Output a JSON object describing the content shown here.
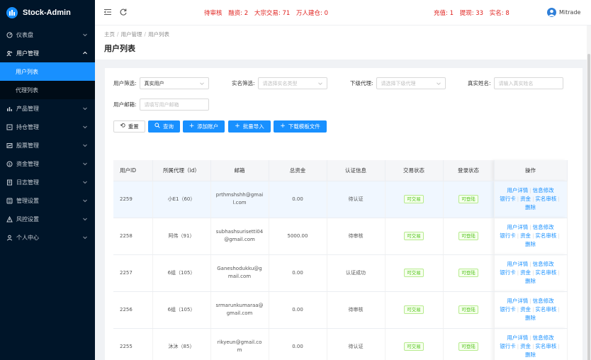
{
  "app": {
    "name": "Stock-Admin"
  },
  "sidebar": {
    "items": [
      {
        "label": "仪表盘",
        "icon": "dashboard-icon"
      },
      {
        "label": "用户管理",
        "icon": "users-icon",
        "open": true,
        "children": [
          {
            "label": "用户列表",
            "active": true
          },
          {
            "label": "代理列表"
          }
        ]
      },
      {
        "label": "产品管理",
        "icon": "chart-icon"
      },
      {
        "label": "持仓管理",
        "icon": "position-icon"
      },
      {
        "label": "股票管理",
        "icon": "stock-icon"
      },
      {
        "label": "资金管理",
        "icon": "money-icon"
      },
      {
        "label": "日志管理",
        "icon": "log-icon"
      },
      {
        "label": "管理设置",
        "icon": "settings-icon"
      },
      {
        "label": "风控设置",
        "icon": "warning-icon"
      },
      {
        "label": "个人中心",
        "icon": "person-icon"
      }
    ]
  },
  "topbar": {
    "stats_left": [
      "待审核",
      "融资: 2",
      "大宗交易: 71",
      "万人建仓: 0"
    ],
    "stats_right": [
      "充值: 1",
      "提现: 33",
      "实名: 8"
    ],
    "user": "Mitrade"
  },
  "breadcrumb": [
    "主页",
    "用户管理",
    "用户列表"
  ],
  "page_title": "用户列表",
  "filters": {
    "user_filter": {
      "label": "用户筛选:",
      "value": "真实用户"
    },
    "realname_filter": {
      "label": "实名筛选:",
      "placeholder": "请选择实名类型"
    },
    "agent_filter": {
      "label": "下级代理:",
      "placeholder": "请选择下级代理"
    },
    "realname_input": {
      "label": "真实姓名:",
      "placeholder": "请输入真实姓名"
    },
    "email_input": {
      "label": "用户邮箱:",
      "placeholder": "请填写用户邮箱"
    }
  },
  "buttons": {
    "reset": "重置",
    "search": "查询",
    "add": "添加账户",
    "import": "批量导入",
    "download": "下载模板文件"
  },
  "table": {
    "columns": [
      "用户ID",
      "所属代理（id）",
      "邮箱",
      "总资金",
      "认证信息",
      "交易状态",
      "登录状态",
      "操作"
    ],
    "rows": [
      {
        "id": "2259",
        "agent": "小E1（60）",
        "email": "prthmshshh@gmail.com",
        "funds": "0.00",
        "auth": "待认证",
        "trade": "可交易",
        "login": "可登陆"
      },
      {
        "id": "2258",
        "agent": "阿伟（91）",
        "email": "subhashsurisetti04@gmail.com",
        "funds": "5000.00",
        "auth": "待审核",
        "trade": "可交易",
        "login": "可登陆"
      },
      {
        "id": "2257",
        "agent": "6组（105）",
        "email": "Ganeshodukku@gmail.com",
        "funds": "0.00",
        "auth": "认证成功",
        "trade": "可交易",
        "login": "可登陆"
      },
      {
        "id": "2256",
        "agent": "6组（105）",
        "email": "srmarunkumaraa@gmail.com",
        "funds": "0.00",
        "auth": "待审核",
        "trade": "可交易",
        "login": "可登陆"
      },
      {
        "id": "2255",
        "agent": "沐沐（85）",
        "email": "rikyeun@gmail.com",
        "funds": "0.00",
        "auth": "待认证",
        "trade": "可交易",
        "login": "可登陆"
      }
    ],
    "actions": [
      "用户详情",
      "信息修改",
      "银行卡",
      "资金",
      "实名审核",
      "删除"
    ]
  },
  "colors": {
    "sidebar_bg": "#001529",
    "primary": "#1890ff",
    "alert": "#e0201d",
    "success": "#52c41a"
  }
}
